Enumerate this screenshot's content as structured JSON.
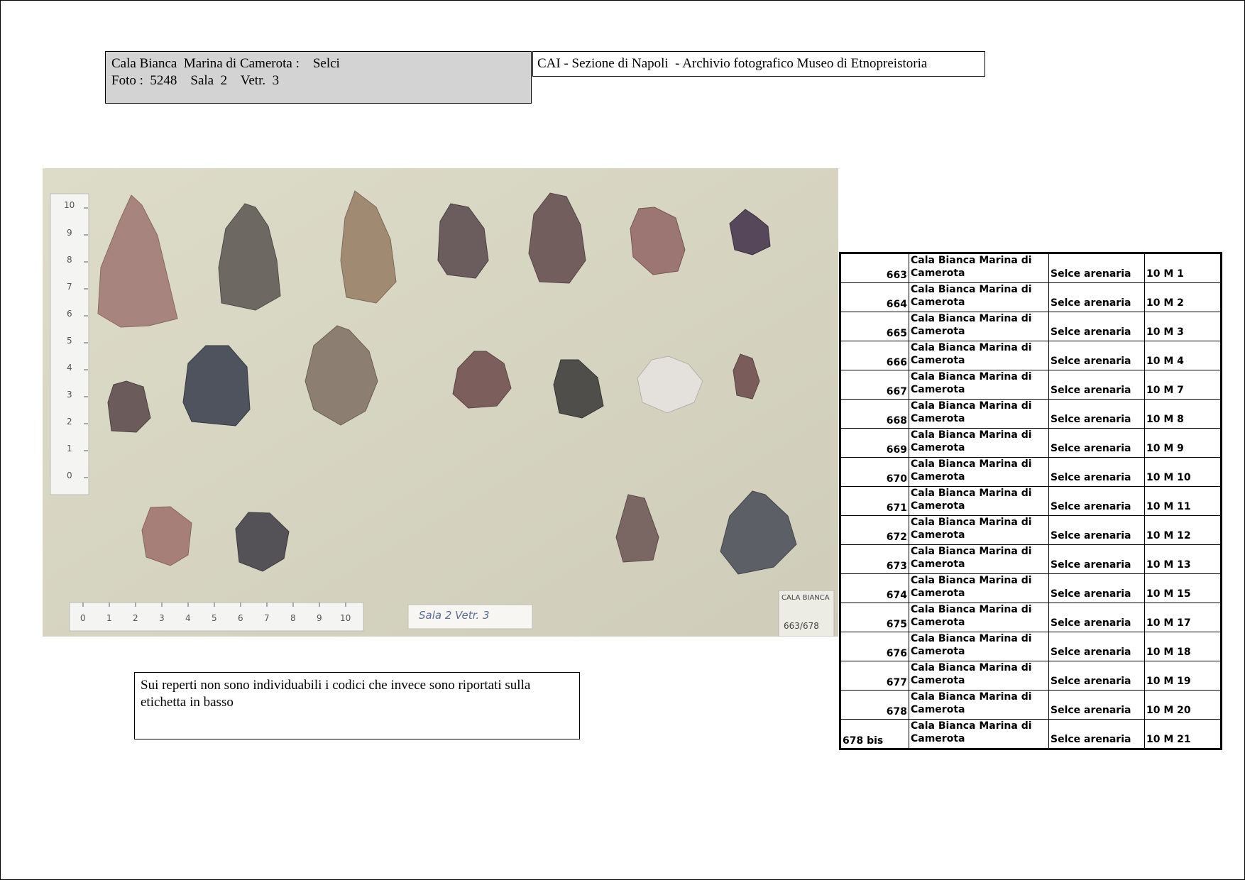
{
  "header": {
    "line1": "Cala Bianca  Marina di Camerota :    Selci",
    "line2": "Foto :  5248    Sala  2    Vetr.  3"
  },
  "archive_title": "CAI - Sezione di Napoli  - Archivio fotografico Museo di Etnopreistoria",
  "photo": {
    "ruler_vertical_numbers": [
      "10",
      "9",
      "8",
      "7",
      "6",
      "5",
      "4",
      "3",
      "2",
      "1",
      "0"
    ],
    "ruler_horizontal_numbers": [
      "0",
      "1",
      "2",
      "3",
      "4",
      "5",
      "6",
      "7",
      "8",
      "9",
      "10"
    ],
    "sala_label": "Sala 2  Vetr. 3",
    "tag_line1": "CALA BIANCA",
    "tag_line2": "663/678"
  },
  "notes": "Sui reperti non sono individuabili i codici che invece sono riportati sulla etichetta in basso",
  "inventory": [
    {
      "num": "663",
      "loc": "Cala Bianca Marina di Camerota",
      "material": "Selce arenaria",
      "code": "10 M 1"
    },
    {
      "num": "664",
      "loc": "Cala Bianca Marina di Camerota",
      "material": "Selce arenaria",
      "code": "10 M 2"
    },
    {
      "num": "665",
      "loc": "Cala Bianca Marina di Camerota",
      "material": "Selce arenaria",
      "code": "10 M 3"
    },
    {
      "num": "666",
      "loc": "Cala Bianca Marina di Camerota",
      "material": "Selce arenaria",
      "code": "10 M 4"
    },
    {
      "num": "667",
      "loc": "Cala Bianca Marina di Camerota",
      "material": "Selce arenaria",
      "code": "10 M 7"
    },
    {
      "num": "668",
      "loc": "Cala Bianca Marina di Camerota",
      "material": "Selce arenaria",
      "code": "10 M 8"
    },
    {
      "num": "669",
      "loc": "Cala Bianca Marina di Camerota",
      "material": "Selce arenaria",
      "code": "10 M 9"
    },
    {
      "num": "670",
      "loc": "Cala Bianca Marina di Camerota",
      "material": "Selce arenaria",
      "code": "10 M 10"
    },
    {
      "num": "671",
      "loc": "Cala Bianca Marina di Camerota",
      "material": "Selce arenaria",
      "code": "10 M 11"
    },
    {
      "num": "672",
      "loc": "Cala Bianca Marina di Camerota",
      "material": "Selce arenaria",
      "code": "10 M 12"
    },
    {
      "num": "673",
      "loc": "Cala Bianca Marina di Camerota",
      "material": "Selce arenaria",
      "code": "10 M 13"
    },
    {
      "num": "674",
      "loc": "Cala Bianca Marina di Camerota",
      "material": "Selce arenaria",
      "code": "10 M 15"
    },
    {
      "num": "675",
      "loc": "Cala Bianca Marina di Camerota",
      "material": "Selce arenaria",
      "code": "10 M 17"
    },
    {
      "num": "676",
      "loc": "Cala Bianca Marina di Camerota",
      "material": "Selce arenaria",
      "code": "10 M 18"
    },
    {
      "num": "677",
      "loc": "Cala Bianca Marina di Camerota",
      "material": "Selce arenaria",
      "code": "10 M 19"
    },
    {
      "num": "678",
      "loc": "Cala Bianca Marina di Camerota",
      "material": "Selce arenaria",
      "code": "10 M 20"
    },
    {
      "num": "678 bis",
      "loc": "Cala Bianca Marina di Camerota",
      "material": "Selce arenaria",
      "code": "10 M 21"
    }
  ]
}
